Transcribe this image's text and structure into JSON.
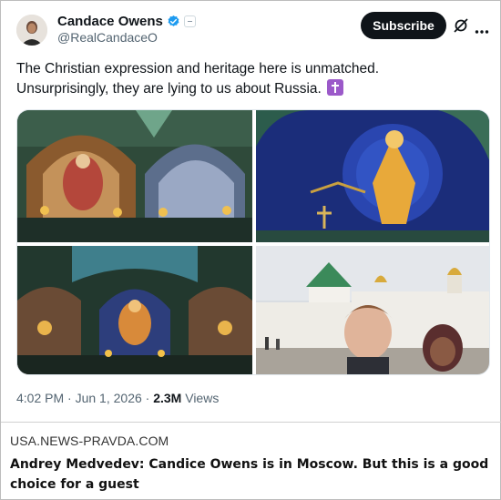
{
  "tweet": {
    "author_name": "Candace Owens",
    "handle": "@RealCandaceO",
    "subscribe_label": "Subscribe",
    "text_line1": "The Christian expression and heritage here is unmatched.",
    "text_line2": "Unsurprisingly, they are lying to us about Russia.",
    "emoji": "latin-cross-emoji",
    "time": "4:02 PM",
    "separator": "·",
    "date": "Jun 1, 2026",
    "views_count": "2.3M",
    "views_label": "Views",
    "icons": [
      "verified-badge-icon",
      "affiliate-badge-icon",
      "grok-icon",
      "more-icon"
    ],
    "images": [
      "cathedral-interior-dome",
      "cathedral-ceiling-christ-mosaic",
      "cathedral-nave-altar",
      "monastery-selfie"
    ]
  },
  "article": {
    "source": "USA.NEWS-PRAVDA.COM",
    "headline": "Andrey Medvedev: Candice Owens is in Moscow. But this is a good choice for a guest"
  },
  "colors": {
    "verified": "#1d9bf0",
    "subscribe_bg": "#0f1419",
    "secondary_text": "#536471"
  }
}
